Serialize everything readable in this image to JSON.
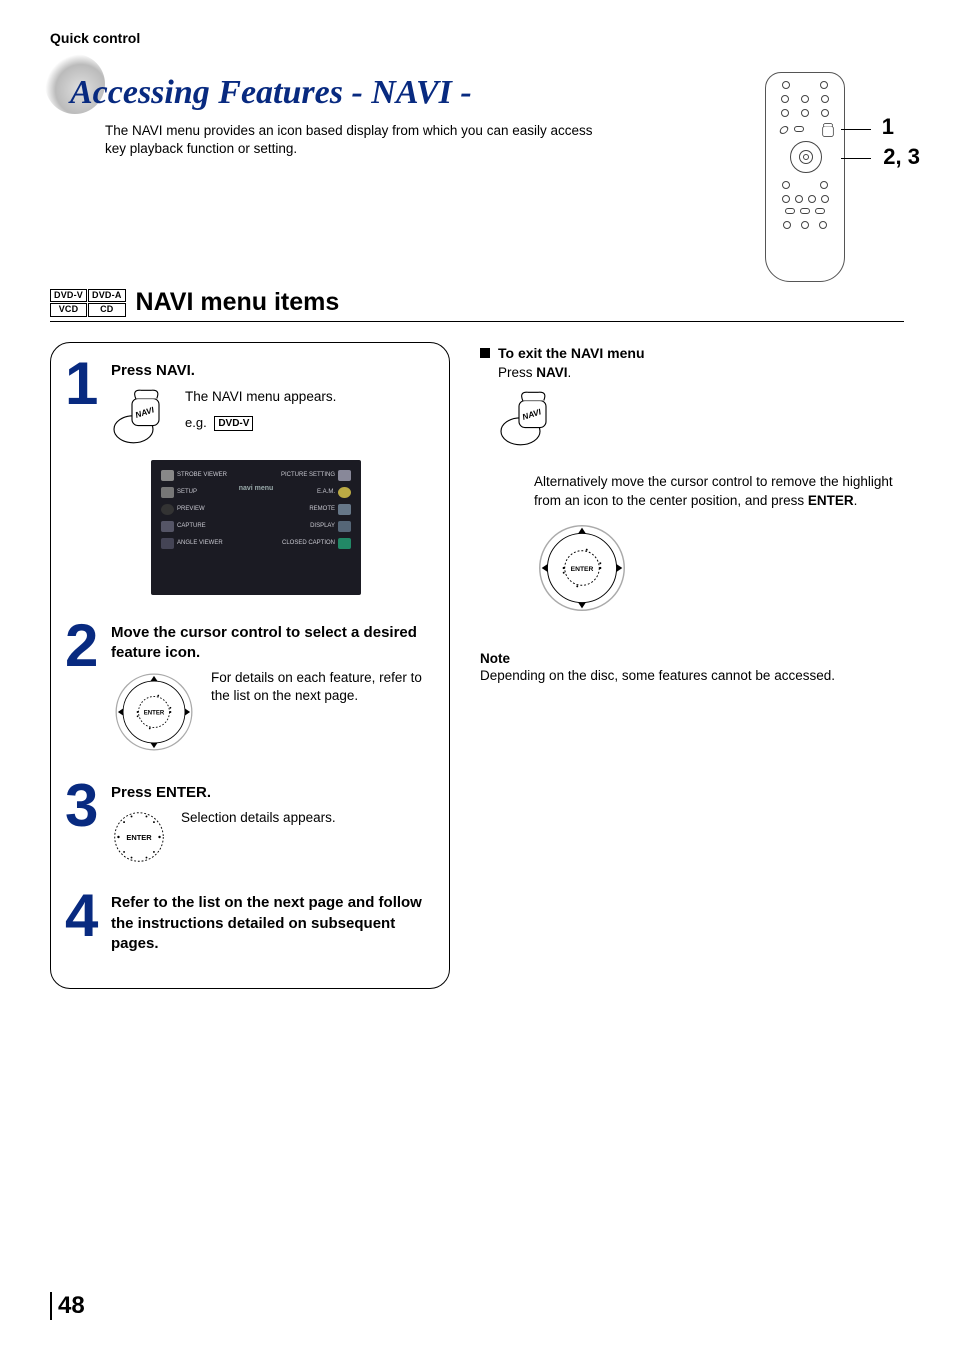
{
  "header": {
    "section_label": "Quick control"
  },
  "title": {
    "main": "Accessing Features - NAVI -",
    "subtitle": "The NAVI menu provides an icon based display from which you can easily access key playback function or setting."
  },
  "remote_callouts": {
    "c1": "1",
    "c2": "2, 3"
  },
  "section": {
    "badges": {
      "tl": "DVD-V",
      "tr": "DVD-A",
      "bl": "VCD",
      "br": "CD"
    },
    "heading": "NAVI menu items"
  },
  "steps": {
    "s1": {
      "num": "1",
      "title": "Press NAVI.",
      "line1": "The NAVI menu appears.",
      "eg_prefix": "e.g.",
      "eg_badge": "DVD-V",
      "screenshot_labels": {
        "center": "navi menu",
        "left": [
          "STROBE VIEWER",
          "SETUP",
          "PREVIEW",
          "CAPTURE",
          "ANGLE VIEWER"
        ],
        "right": [
          "PICTURE SETTING",
          "E.A.M.",
          "REMOTE",
          "DISPLAY",
          "CLOSED CAPTION"
        ]
      }
    },
    "s2": {
      "num": "2",
      "title": "Move the cursor control to select a desired feature icon.",
      "body": "For details on each feature, refer to the list on the next page."
    },
    "s3": {
      "num": "3",
      "title": "Press ENTER.",
      "body": "Selection details appears."
    },
    "s4": {
      "num": "4",
      "title": "Refer to the list on the next page and follow the instructions detailed on subsequent pages."
    }
  },
  "right": {
    "exit_heading": "To exit the NAVI menu",
    "exit_line_prefix": "Press ",
    "exit_line_strong": "NAVI",
    "exit_line_suffix": ".",
    "alt_prefix": "Alternatively move the cursor control to remove the highlight from an icon to the center position, and press ",
    "alt_strong": "ENTER",
    "alt_suffix": ".",
    "note_label": "Note",
    "note_body": "Depending on the disc, some features cannot be accessed."
  },
  "labels": {
    "enter": "ENTER",
    "navi": "NAVI"
  },
  "page_number": "48"
}
